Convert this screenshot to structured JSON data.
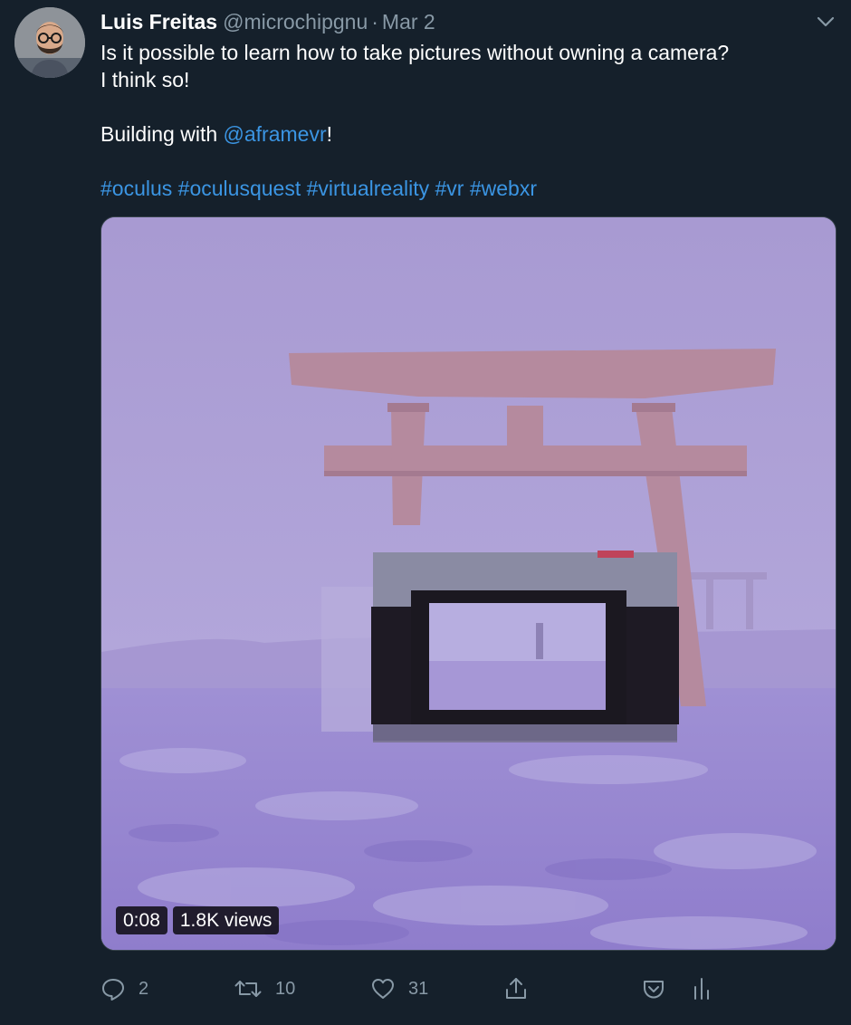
{
  "author": {
    "name": "Luis Freitas",
    "handle": "@microchipgnu",
    "separator": "·",
    "date": "Mar 2",
    "avatar_icon": "user-avatar-icon"
  },
  "tweet": {
    "line1": "Is it possible to learn how to take pictures without owning a camera?",
    "line2": "I think so!",
    "line3_prefix": "Building with ",
    "mention": "@aframevr",
    "line3_suffix": "!",
    "hashtags": [
      "#oculus",
      "#oculusquest",
      "#virtualreality",
      "#vr",
      "#webxr"
    ]
  },
  "media": {
    "type": "video",
    "duration": "0:08",
    "views": "1.8K views"
  },
  "actions": {
    "reply_count": "2",
    "retweet_count": "10",
    "like_count": "31"
  },
  "colors": {
    "background": "#15202b",
    "link": "#3b95e3",
    "muted": "#8899a6",
    "video_tint": "#a393d0"
  }
}
